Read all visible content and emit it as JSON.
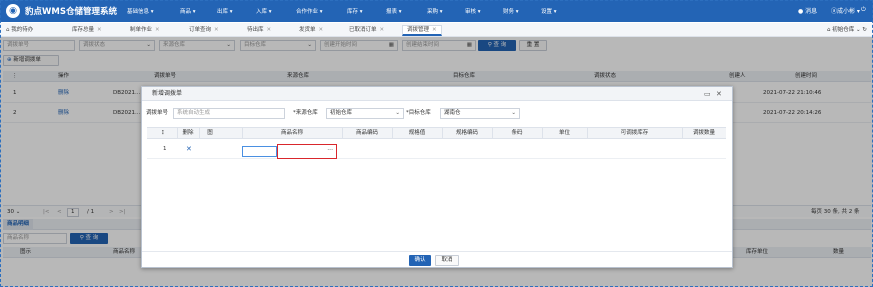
{
  "app": {
    "title": "豹点WMS仓储管理系统"
  },
  "menu": [
    "基础信息 ▾",
    "商品 ▾",
    "出库 ▾",
    "入库 ▾",
    "合作作业 ▾",
    "库存 ▾",
    "报表 ▾",
    "采购 ▾",
    "审核 ▾",
    "财务 ▾",
    "设置 ▾"
  ],
  "top_right": {
    "messages": "消息",
    "user": "成小彬 ▾",
    "power_icon": "power-icon"
  },
  "tabs": [
    {
      "label": "我的待办"
    },
    {
      "label": "库存总量"
    },
    {
      "label": "制单作业"
    },
    {
      "label": "订单查询"
    },
    {
      "label": "待出库"
    },
    {
      "label": "发货单"
    },
    {
      "label": "已取消订单"
    },
    {
      "label": "调拨管理"
    }
  ],
  "warehouse": {
    "label": "初始仓库",
    "dropdown": "⌄",
    "refresh": "↻"
  },
  "filters": {
    "no": "调拨单号",
    "status": "调拨状态",
    "source": "来源仓库",
    "target": "目标仓库",
    "start": "创建开始时间",
    "end": "创建结束时间",
    "search": "查 询",
    "reset": "重 置"
  },
  "add_button": "新增调拨单",
  "grid": {
    "headers": [
      "操作",
      "调拨单号",
      "来源仓库",
      "目标仓库",
      "调拨状态",
      "创建人",
      "创建时间"
    ],
    "rows": [
      {
        "idx": "1",
        "op": "删除",
        "no": "DB2021...",
        "time": "2021-07-22 21:10:46"
      },
      {
        "idx": "2",
        "op": "删除",
        "no": "DB2021...",
        "time": "2021-07-22 20:14:26"
      }
    ]
  },
  "pager": {
    "size": "30",
    "first": "|<",
    "prev": "<",
    "page": "1",
    "total_pages": "/ 1",
    "next": ">",
    "last": ">|",
    "summary": "每页 30 条, 共 2 条"
  },
  "detail": {
    "tab": "商品明细",
    "name_placeholder": "商品名称",
    "search": "查 询",
    "headers": [
      "图示",
      "商品名称",
      "库存单位",
      "数量"
    ]
  },
  "modal": {
    "title": "新增调拨单",
    "no_label": "调拨单号",
    "no_placeholder": "系统自动生成",
    "source_label": "*来源仓库",
    "source_value": "初始仓库",
    "target_label": "*目标仓库",
    "target_value": "湖南仓",
    "headers": [
      "删除",
      "图",
      "商品名称",
      "商品编码",
      "规格值",
      "规格编码",
      "条码",
      "单位",
      "可调拨库存",
      "调拨数量"
    ],
    "row": {
      "idx": "1",
      "delete": "✕",
      "picker": "···"
    },
    "confirm": "确认",
    "cancel": "取消",
    "min_icon": "▭",
    "close_icon": "✕"
  },
  "colors": {
    "primary": "#2364b5",
    "highlight": "#d9262c"
  }
}
